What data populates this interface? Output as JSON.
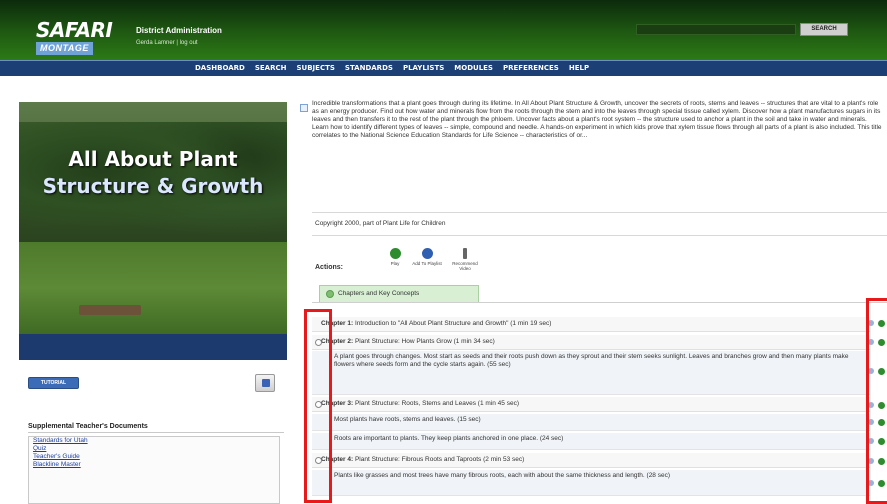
{
  "header": {
    "logo_main": "SAFARI",
    "logo_sub": "MONTAGE",
    "district": "District Administration",
    "user_line": "Gerda Lamner | log out",
    "search_button": "SEARCH",
    "search_value": ""
  },
  "nav": {
    "items": [
      "DASHBOARD",
      "SEARCH",
      "SUBJECTS",
      "STANDARDS",
      "PLAYLISTS",
      "MODULES",
      "PREFERENCES",
      "HELP"
    ]
  },
  "video": {
    "title_line1": "All About Plant",
    "title_line2": "Structure & Growth"
  },
  "left": {
    "tutorial_label": "TUTORIAL",
    "supplemental_title": "Supplemental Teacher's Documents",
    "documents": [
      "Standards for Utah",
      "Quiz",
      "Teacher's Guide",
      "Blackline Master"
    ]
  },
  "description": "Incredible transformations that a plant goes through during its lifetime. In All About Plant Structure & Growth, uncover the secrets of roots, stems and leaves -- structures that are vital to a plant's role as an energy producer. Find out how water and minerals flow from the roots through the stem and into the leaves through special tissue called xylem. Discover how a plant manufactures sugars in its leaves and then transfers it to the rest of the plant through the phloem. Uncover facts about a plant's root system -- the structure used to anchor a plant in the soil and take in water and minerals. Learn how to identify different types of leaves -- simple, compound and needle. A hands-on experiment in which kids prove that xylem tissue flows through all parts of a plant is also included. This title correlates to the National Science Education Standards for Life Science -- characteristics of or...",
  "copyright": "Copyright 2000, part of Plant Life for Children",
  "actions": {
    "label": "Actions:",
    "items": [
      {
        "label": "Play",
        "color": "#2e8b2e"
      },
      {
        "label": "Add To Playlist",
        "color": "#2f5fb0"
      },
      {
        "label": "Recommend Video",
        "color": "#666666"
      }
    ]
  },
  "tabs": {
    "chapters_label": "Chapters and Key Concepts"
  },
  "chapters": [
    {
      "type": "chapter",
      "title": "Chapter 1:",
      "text": "Introduction to \"All About Plant Structure and Growth\" (1 min 19 sec)"
    },
    {
      "type": "chapter",
      "title": "Chapter 2:",
      "text": "Plant Structure: How Plants Grow (1 min 34 sec)"
    },
    {
      "type": "concept",
      "text": "A plant goes through changes. Most start as seeds and their roots push down as they sprout and their stem seeks sunlight. Leaves and branches grow and then many plants make flowers where seeds form and the cycle starts again. (55 sec)"
    },
    {
      "type": "chapter",
      "title": "Chapter 3:",
      "text": "Plant Structure: Roots, Stems and Leaves (1 min 45 sec)"
    },
    {
      "type": "concept",
      "text": "Most plants have roots, stems and leaves. (15 sec)"
    },
    {
      "type": "concept",
      "text": "Roots are important to plants. They keep plants anchored in one place. (24 sec)"
    },
    {
      "type": "chapter",
      "title": "Chapter 4:",
      "text": "Plant Structure: Fibrous Roots and Taproots (2 min 53 sec)"
    },
    {
      "type": "concept",
      "text": "Plants like grasses and most trees have many fibrous roots, each with about the same thickness and length. (28 sec)"
    }
  ],
  "colors": {
    "header_green": "#1f5a12",
    "nav_blue": "#1c3f75",
    "highlight_red": "#e8191b",
    "link_blue": "#1b3fa0"
  }
}
